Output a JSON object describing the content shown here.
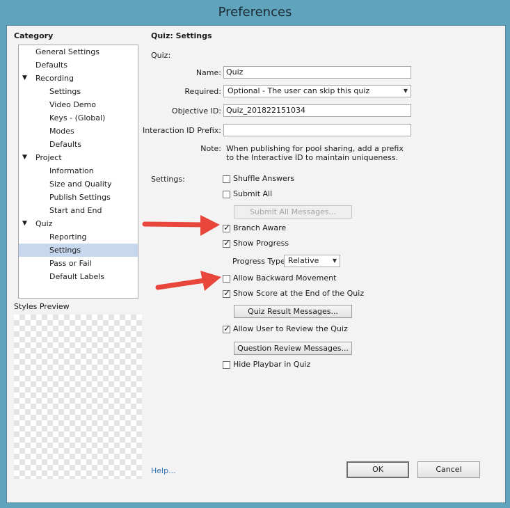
{
  "window": {
    "title": "Preferences"
  },
  "sidebar": {
    "heading": "Category",
    "items": [
      {
        "label": "General Settings"
      },
      {
        "label": "Defaults"
      },
      {
        "label": "Recording",
        "toggle": "▼"
      },
      {
        "label": "Settings"
      },
      {
        "label": "Video Demo"
      },
      {
        "label": "Keys - (Global)"
      },
      {
        "label": "Modes"
      },
      {
        "label": "Defaults"
      },
      {
        "label": "Project",
        "toggle": "▼"
      },
      {
        "label": "Information"
      },
      {
        "label": "Size and Quality"
      },
      {
        "label": "Publish Settings"
      },
      {
        "label": "Start and End"
      },
      {
        "label": "Quiz",
        "toggle": "▼"
      },
      {
        "label": "Reporting"
      },
      {
        "label": "Settings"
      },
      {
        "label": "Pass or Fail"
      },
      {
        "label": "Default Labels"
      }
    ],
    "styles_preview_label": "Styles Preview"
  },
  "panel": {
    "title": "Quiz: Settings",
    "quiz_label": "Quiz:",
    "name_label": "Name:",
    "name_value": "Quiz",
    "required_label": "Required:",
    "required_value": "Optional - The user can skip this quiz",
    "objective_label": "Objective ID:",
    "objective_value": "Quiz_201822151034",
    "interaction_label": "Interaction ID Prefix:",
    "interaction_value": "",
    "note_label": "Note:",
    "note_line1": "When publishing for pool sharing, add a prefix",
    "note_line2": "to the Interactive ID to maintain uniqueness.",
    "settings_label": "Settings:",
    "shuffle_answers": "Shuffle Answers",
    "submit_all": "Submit All",
    "submit_all_messages": "Submit All Messages...",
    "branch_aware": "Branch Aware",
    "show_progress": "Show Progress",
    "progress_type_label": "Progress Type:",
    "progress_type_value": "Relative",
    "allow_backward": "Allow Backward Movement",
    "show_score": "Show Score at the End of the Quiz",
    "quiz_result_messages": "Quiz Result Messages...",
    "allow_review": "Allow User to Review the Quiz",
    "question_review_messages": "Question Review Messages...",
    "hide_playbar": "Hide Playbar in Quiz"
  },
  "checkmark": "✓",
  "footer": {
    "help": "Help...",
    "ok": "OK",
    "cancel": "Cancel"
  },
  "colors": {
    "arrow": "#e8463b",
    "selection": "#c6d7ee",
    "frame": "#5fa3bc"
  }
}
